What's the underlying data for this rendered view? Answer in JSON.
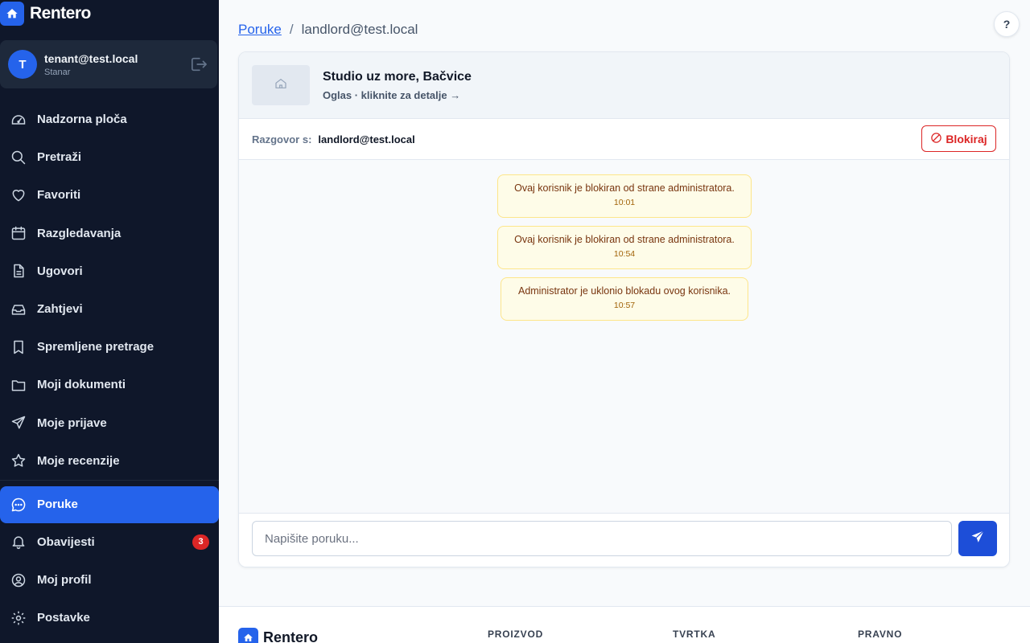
{
  "app": {
    "name": "Rentero"
  },
  "user": {
    "initial": "T",
    "email": "tenant@test.local",
    "role": "Stanar"
  },
  "nav": {
    "items": [
      {
        "label": "Nadzorna ploča",
        "icon": "dashboard-icon"
      },
      {
        "label": "Pretraži",
        "icon": "search-icon"
      },
      {
        "label": "Favoriti",
        "icon": "heart-icon"
      },
      {
        "label": "Razgledavanja",
        "icon": "calendar-icon"
      },
      {
        "label": "Ugovori",
        "icon": "document-icon"
      },
      {
        "label": "Zahtjevi",
        "icon": "inbox-icon"
      },
      {
        "label": "Spremljene pretrage",
        "icon": "bookmark-icon"
      },
      {
        "label": "Moji dokumenti",
        "icon": "folder-icon"
      },
      {
        "label": "Moje prijave",
        "icon": "send-icon"
      },
      {
        "label": "Moje recenzije",
        "icon": "star-icon"
      }
    ],
    "bottom": [
      {
        "label": "Poruke",
        "icon": "chat-icon",
        "active": true
      },
      {
        "label": "Obavijesti",
        "icon": "bell-icon",
        "badge": "3"
      },
      {
        "label": "Moj profil",
        "icon": "user-circle-icon"
      },
      {
        "label": "Postavke",
        "icon": "gear-icon"
      }
    ]
  },
  "breadcrumb": {
    "parent": "Poruke",
    "separator": "/",
    "current": "landlord@test.local"
  },
  "help": {
    "label": "?"
  },
  "listing": {
    "title": "Studio uz more, Bačvice",
    "subtitle": "Oglas · kliknite za detalje →"
  },
  "conversation": {
    "label": "Razgovor s:",
    "with": "landlord@test.local",
    "block_label": "Blokiraj"
  },
  "messages": [
    {
      "text": "Ovaj korisnik je blokiran od strane administratora.",
      "time": "10:01"
    },
    {
      "text": "Ovaj korisnik je blokiran od strane administratora.",
      "time": "10:54"
    },
    {
      "text": "Administrator je uklonio blokadu ovog korisnika.",
      "time": "10:57"
    }
  ],
  "composer": {
    "placeholder": "Napišite poruku..."
  },
  "footer": {
    "brand": "Rentero",
    "columns": [
      "PROIZVOD",
      "TVRTKA",
      "PRAVNO"
    ]
  },
  "colors": {
    "accent": "#2563eb",
    "sidebar": "#0f172a",
    "danger": "#dc2626",
    "system_msg_bg": "#fefce8"
  }
}
